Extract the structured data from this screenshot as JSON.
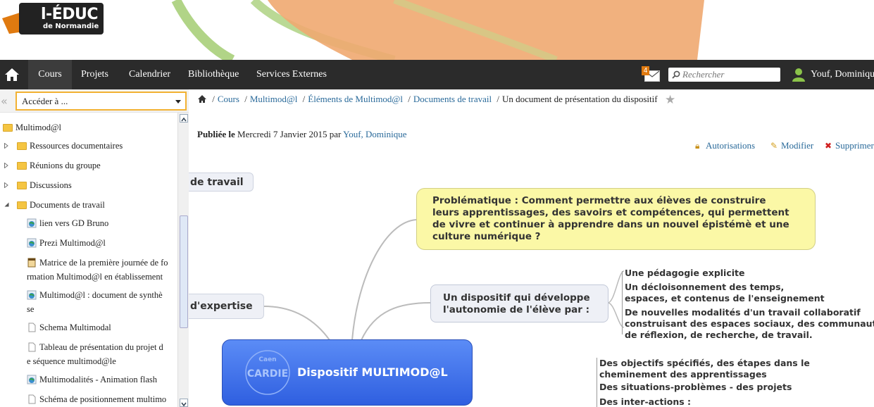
{
  "colors": {
    "accent": "#f2b233",
    "nav_bg": "#2b2b2b",
    "link": "#2a6a9a",
    "brand_orange": "#e07a10"
  },
  "logo": {
    "main": "l-ÉDUC",
    "sub": "de Normandie"
  },
  "nav": {
    "items": [
      "Cours",
      "Projets",
      "Calendrier",
      "Bibliothèque",
      "Services Externes"
    ],
    "active": "Cours",
    "mail_count": "4",
    "search_placeholder": "Rechercher",
    "user": "Youf, Dominique"
  },
  "sidebar": {
    "acceder": "Accéder à ...",
    "root": "Multimod@l",
    "folders": [
      "Ressources documentaires",
      "Réunions du groupe",
      "Discussions",
      "Documents de travail"
    ],
    "documents": [
      {
        "lines": [
          "lien vers GD Bruno"
        ],
        "icon": "globe-icon"
      },
      {
        "lines": [
          "Prezi Multimod@l"
        ],
        "icon": "globe-icon"
      },
      {
        "lines": [
          "Matrice de la première journée de fo",
          "rmation Multimod@l en établissement"
        ],
        "icon": "book-icon"
      },
      {
        "lines": [
          "Multimod@l : document de synthè",
          "se"
        ],
        "icon": "globe-icon"
      },
      {
        "lines": [
          "Schema Multimodal"
        ],
        "icon": "page-icon"
      },
      {
        "lines": [
          "Tableau de présentation du projet d",
          "e séquence multimod@le"
        ],
        "icon": "page-icon"
      },
      {
        "lines": [
          "Multimodalités - Animation flash"
        ],
        "icon": "globe-icon"
      },
      {
        "lines": [
          "Schéma de positionnement multimo"
        ],
        "icon": "page-icon"
      }
    ]
  },
  "breadcrumb": {
    "links": [
      "Cours",
      "Multimod@l",
      "Éléments de Multimod@l",
      "Documents de travail"
    ],
    "current": "Un document de présentation du dispositif"
  },
  "meta": {
    "label": "Publiée le",
    "date": "Mercredi 7 Janvier 2015",
    "by": "par",
    "author": "Youf, Dominique"
  },
  "actions": {
    "permissions": "Autorisations",
    "edit": "Modifier",
    "delete": "Supprimer"
  },
  "mindmap": {
    "central": "Dispositif MULTIMOD@L",
    "central_logo_top": "Caen",
    "central_logo": "CARDIE",
    "partial_top": "de travail",
    "partial_mid": "d'expertise",
    "problem": [
      "Problématique : Comment permettre aux élèves de construire",
      "leurs apprentissages,  des savoirs et compétences, qui permettent",
      "de vivre et continuer à apprendre dans un nouvel épistémè et une",
      "culture numérique ?"
    ],
    "autonomy": [
      "Un dispositif qui développe",
      "l'autonomie de l'élève par :"
    ],
    "autonomy_items": [
      [
        "Une pédagogie explicite"
      ],
      [
        "Un décloisonnement des temps,",
        "espaces, et contenus de l'enseignement"
      ],
      [
        "De nouvelles modalités d'un travail collaboratif",
        "construisant des espaces sociaux, des communauté",
        "de réflexion, de recherche,  de travail."
      ]
    ],
    "lower_items": [
      [
        "Des objectifs spécifiés, des étapes dans le",
        "cheminement des apprentissages"
      ],
      [
        "Des situations-problèmes - des projets"
      ],
      [
        "Des inter-actions :"
      ]
    ]
  }
}
